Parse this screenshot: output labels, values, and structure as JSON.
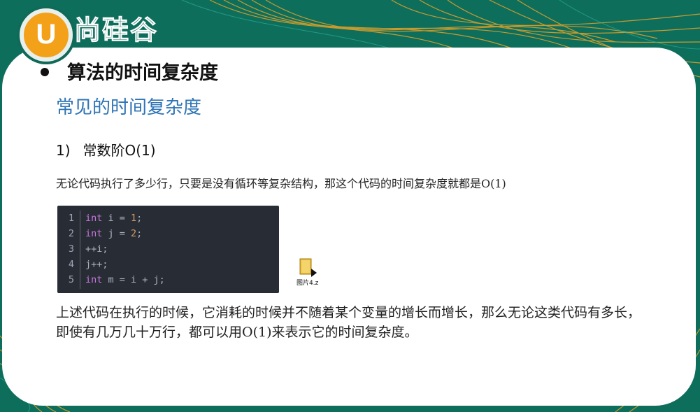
{
  "logo": {
    "badge": "U",
    "text": "尚硅谷"
  },
  "slide": {
    "bullet_title": "算法的时间复杂度",
    "subtitle": "常见的时间复杂度",
    "item": {
      "number": "1)",
      "title": "常数阶O(1)"
    },
    "description": "无论代码执行了多少行，只要是没有循环等复杂结构，那这个代码的时间复杂度就都是O(1)",
    "code_lines": [
      {
        "n": "1",
        "text": "int i = 1;"
      },
      {
        "n": "2",
        "text": "int j = 2;"
      },
      {
        "n": "3",
        "text": "++i;"
      },
      {
        "n": "4",
        "text": "j++;"
      },
      {
        "n": "5",
        "text": "int m = i + j;"
      }
    ],
    "file_icon": {
      "icon": "folder-file-icon",
      "label": "图片4.z"
    },
    "paragraph": "上述代码在执行的时候，它消耗的时候并不随着某个变量的增长而增长，那么无论这类代码有多长，即使有几万几十万行，都可以用O(1)来表示它的时间复杂度。"
  },
  "colors": {
    "background": "#0e6e5c",
    "accent_orange": "#f4a11a",
    "subtitle_blue": "#2e74b5",
    "code_bg": "#282c34",
    "keyword": "#c678dd",
    "number": "#d19a66"
  }
}
